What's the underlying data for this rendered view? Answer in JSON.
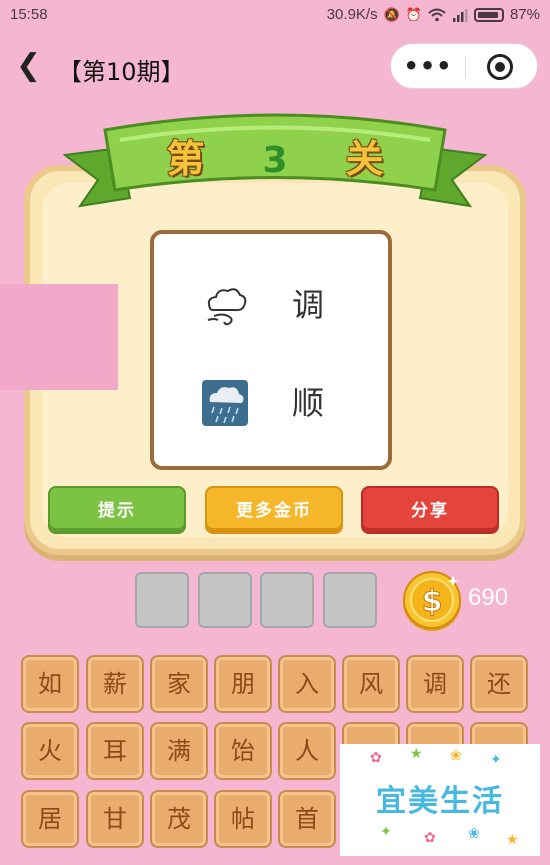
{
  "status_bar": {
    "time": "15:58",
    "network_speed": "30.9K/s",
    "battery": "87%",
    "icons": [
      "mute-icon",
      "alarm-icon",
      "wifi-icon",
      "signal-icon",
      "battery-icon"
    ]
  },
  "title_bar": {
    "back_icon": "chevron-left-icon",
    "title": "【第10期】",
    "more_icon": "more-dots-icon",
    "close_icon": "target-close-icon"
  },
  "level": {
    "prefix": "第",
    "number": "3",
    "suffix": "关"
  },
  "puzzle": {
    "clues": [
      {
        "icon": "wind-cloud-icon",
        "char": "调"
      },
      {
        "icon": "rain-cloud-icon",
        "char": "顺"
      }
    ]
  },
  "actions": {
    "hint": "提示",
    "more_coins": "更多金币",
    "share": "分享"
  },
  "answer": {
    "slot_count": 4
  },
  "coins": {
    "count": "690",
    "icon": "dollar-coin-icon"
  },
  "tiles": [
    [
      "如",
      "薪",
      "家",
      "朋",
      "入",
      "风",
      "调",
      "还"
    ],
    [
      "火",
      "耳",
      "满",
      "饴",
      "人",
      "",
      "",
      ""
    ],
    [
      "居",
      "甘",
      "茂",
      "帖",
      "首",
      "",
      "",
      ""
    ]
  ],
  "watermark": {
    "text": "宜美生活"
  },
  "colors": {
    "background": "#f4b6d0",
    "hint_button": "#7cc243",
    "coins_button": "#f7b72b",
    "share_button": "#e4443c",
    "tile": "#e9ac6c",
    "level_number": "#2f8d2a"
  }
}
